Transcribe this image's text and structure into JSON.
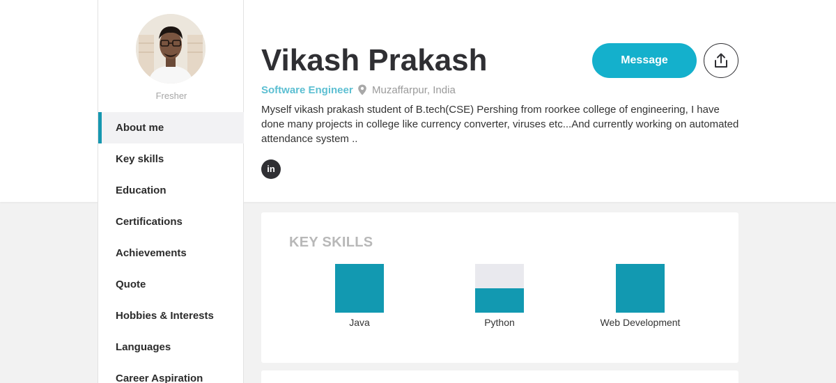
{
  "profile": {
    "name": "Vikash Prakash",
    "role": "Software Engineer",
    "location": "Muzaffarpur, India",
    "status": "Fresher",
    "about": "Myself vikash prakash student of B.tech(CSE) Pershing from roorkee college of engineering, I have done many projects in college like currency converter, viruses etc...And currently working on automated attendance system ..",
    "linkedin_glyph": "in"
  },
  "actions": {
    "message_label": "Message",
    "share_icon": "share-upload-icon"
  },
  "nav": {
    "items": [
      {
        "label": "About me",
        "active": true
      },
      {
        "label": "Key skills",
        "active": false
      },
      {
        "label": "Education",
        "active": false
      },
      {
        "label": "Certifications",
        "active": false
      },
      {
        "label": "Achievements",
        "active": false
      },
      {
        "label": "Quote",
        "active": false
      },
      {
        "label": "Hobbies & Interests",
        "active": false
      },
      {
        "label": "Languages",
        "active": false
      },
      {
        "label": "Career Aspiration",
        "active": false
      }
    ]
  },
  "skills": {
    "title": "KEY SKILLS",
    "items": [
      {
        "label": "Java",
        "level": 1.0
      },
      {
        "label": "Python",
        "level": 0.5
      },
      {
        "label": "Web Development",
        "level": 1.0
      }
    ]
  },
  "colors": {
    "accent": "#14b0cc",
    "skill_fill": "#1299b1",
    "role_text": "#5cbfd2",
    "dark": "#2f2f33"
  }
}
